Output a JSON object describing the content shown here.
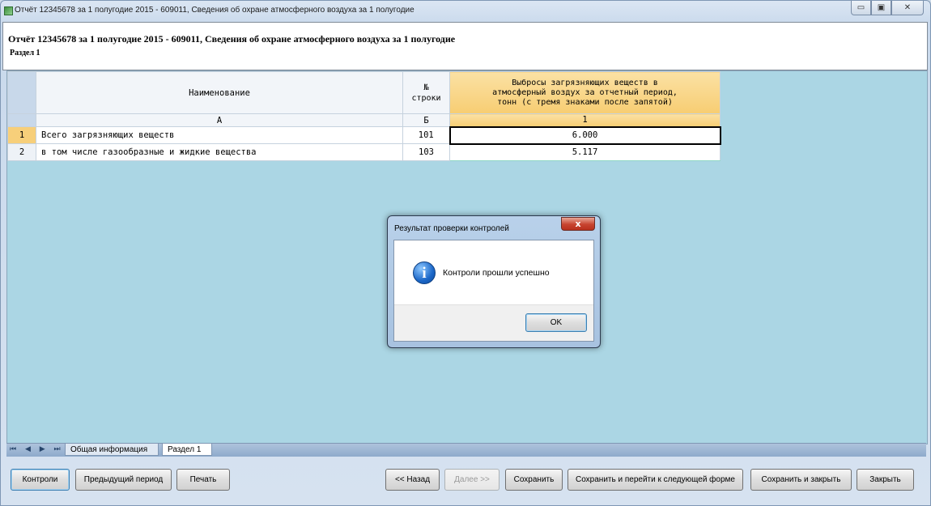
{
  "window": {
    "title": "Отчёт 12345678 за 1 полугодие 2015 - 609011, Сведения об охране атмосферного воздуха за 1 полугодие",
    "controls": [
      "minimize-icon",
      "maximize-icon",
      "close-icon"
    ],
    "minimize_glyph": "▭",
    "maximize_glyph": "▣",
    "close_glyph": "✕"
  },
  "header": {
    "title": "Отчёт 12345678 за 1 полугодие 2015 - 609011, Сведения об охране атмосферного воздуха за 1 полугодие",
    "section": "Раздел 1"
  },
  "grid": {
    "columns": [
      {
        "header": "Наименование",
        "letter": "А"
      },
      {
        "header": "№ строки",
        "letter": "Б"
      },
      {
        "header": "Выбросы загрязняющих веществ в атмосферный воздух за отчетный период, тонн (с тремя знаками после запятой)",
        "letter": "1"
      }
    ],
    "col_no_line1": "№",
    "col_no_line2": "строки",
    "col_val_line1": "Выбросы загрязняющих веществ в",
    "col_val_line2": "атмосферный воздух за отчетный период,",
    "col_val_line3": "тонн (с тремя знаками после запятой)",
    "rows": [
      {
        "num": "1",
        "name": "Всего загрязняющих веществ",
        "code": "101",
        "value": "6.000"
      },
      {
        "num": "2",
        "name": "в том числе газообразные и жидкие вещества",
        "code": "103",
        "value": "5.117"
      }
    ]
  },
  "sheet_tabs": {
    "nav": "⏮ ◀ ▶ ⏭",
    "tabs": [
      "Общая информация",
      "Раздел 1"
    ],
    "active": "Раздел 1"
  },
  "buttons": {
    "controls": "Контроли",
    "prev_period": "Предыдущий период",
    "print": "Печать",
    "back": "<< Назад",
    "next": "Далее >>",
    "save": "Сохранить",
    "save_next": "Сохранить и перейти к следующей форме",
    "save_close": "Сохранить и закрыть",
    "close": "Закрыть"
  },
  "dialog": {
    "title": "Результат проверки контролей",
    "message": "Контроли прошли успешно",
    "ok": "OK",
    "close_glyph": "x",
    "icon_glyph": "i",
    "icon": "info-icon"
  }
}
